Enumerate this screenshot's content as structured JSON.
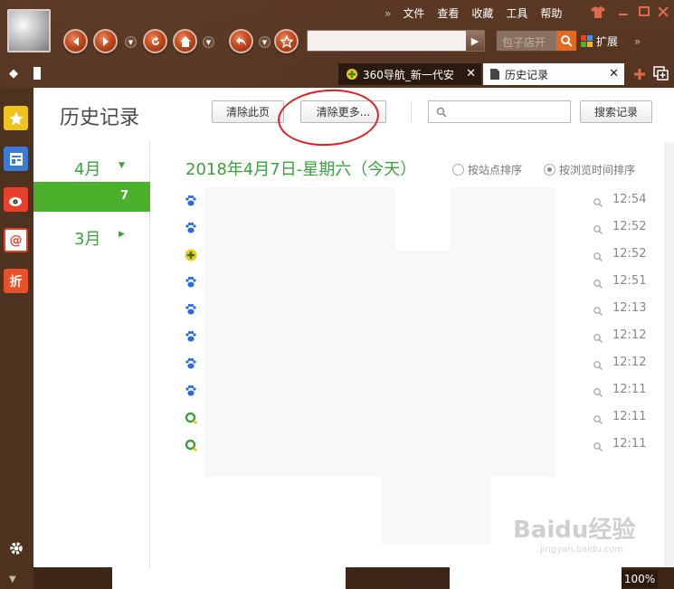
{
  "menu": [
    "文件",
    "查看",
    "收藏",
    "工具",
    "帮助"
  ],
  "search_placeholder": "包子店开",
  "extensions_label": "扩展",
  "tabs": [
    {
      "label": "360导航_新一代安",
      "active": false
    },
    {
      "label": "历史记录",
      "active": true
    }
  ],
  "page": {
    "title": "历史记录",
    "clear_page_label": "清除此页",
    "clear_more_label": "清除更多...",
    "search_records_label": "搜索记录",
    "search_placeholder": ""
  },
  "months": [
    {
      "label": "4月",
      "expanded": true
    },
    {
      "label": "3月",
      "expanded": false
    }
  ],
  "selected_day": "7",
  "day_heading": "2018年4月7日-星期六（今天）",
  "sort": {
    "by_site_label": "按站点排序",
    "by_time_label": "按浏览时间排序",
    "selected": "by_time"
  },
  "history_rows": [
    {
      "icon": "baidu-paw-icon",
      "time": "12:54"
    },
    {
      "icon": "baidu-paw-icon",
      "time": "12:52"
    },
    {
      "icon": "360-icon",
      "time": "12:52"
    },
    {
      "icon": "baidu-paw-icon",
      "time": "12:51"
    },
    {
      "icon": "baidu-paw-icon",
      "time": "12:13"
    },
    {
      "icon": "baidu-paw-icon",
      "time": "12:12"
    },
    {
      "icon": "baidu-paw-icon",
      "time": "12:12"
    },
    {
      "icon": "baidu-paw-icon",
      "time": "12:11"
    },
    {
      "icon": "360-search-icon",
      "time": "12:11"
    },
    {
      "icon": "360-search-icon",
      "time": "12:11"
    }
  ],
  "zoom": "100%",
  "watermark": {
    "text": "Baidu经验",
    "sub": "jingyan.baidu.com"
  },
  "colors": {
    "accent_green": "#4bb02b",
    "annotation_red": "#e02020"
  }
}
